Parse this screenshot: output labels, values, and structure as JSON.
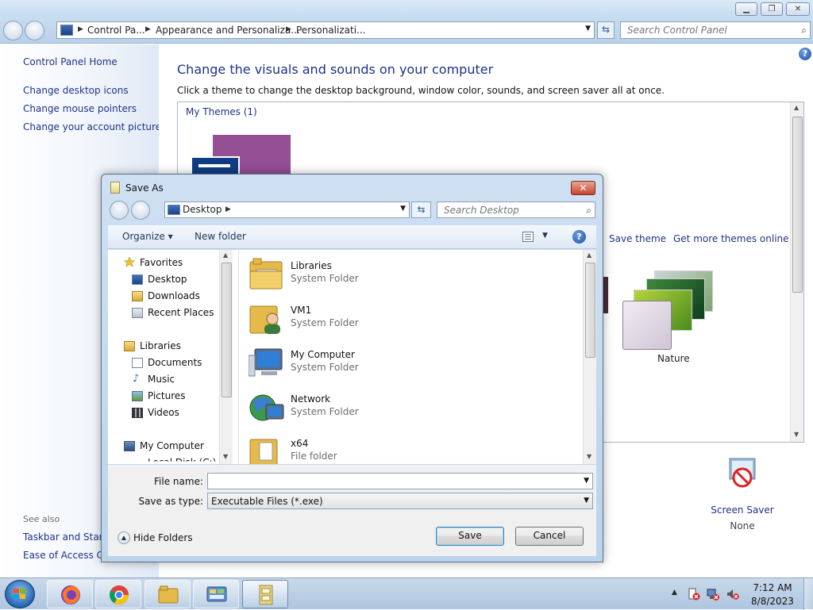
{
  "control_panel": {
    "breadcrumbs": [
      "Control Pa...",
      "Appearance and Personaliza...",
      "Personalizati..."
    ],
    "search_placeholder": "Search Control Panel",
    "left_links": [
      "Control Panel Home",
      "Change desktop icons",
      "Change mouse pointers",
      "Change your account picture"
    ],
    "see_also_label": "See also",
    "see_also_links": [
      "Taskbar and Start M",
      "Ease of Access Cer"
    ],
    "heading": "Change the visuals and sounds on your computer",
    "subheading": "Click a theme to change the desktop background, window color, sounds, and screen saver all at once.",
    "my_themes_label": "My Themes (1)",
    "save_theme": "Save theme",
    "get_more_themes": "Get more themes online",
    "nature_theme": "Nature",
    "screen_saver_label": "Screen Saver",
    "screen_saver_value": "None",
    "help_glyph": "?"
  },
  "dialog": {
    "title": "Save As",
    "close_glyph": "✕",
    "location": "Desktop",
    "search_placeholder": "Search Desktop",
    "toolbar": {
      "organize": "Organize ▾",
      "new_folder": "New folder",
      "help_glyph": "?"
    },
    "nav": {
      "favorites": "Favorites",
      "favorites_items": [
        "Desktop",
        "Downloads",
        "Recent Places"
      ],
      "libraries": "Libraries",
      "libraries_items": [
        "Documents",
        "Music",
        "Pictures",
        "Videos"
      ],
      "computer": "My Computer",
      "computer_partial": "Local Disk (C:)"
    },
    "files": [
      {
        "name": "Libraries",
        "type": "System Folder"
      },
      {
        "name": "VM1",
        "type": "System Folder"
      },
      {
        "name": "My Computer",
        "type": "System Folder"
      },
      {
        "name": "Network",
        "type": "System Folder"
      },
      {
        "name": "x64",
        "type": "File folder"
      }
    ],
    "file_name_label": "File name:",
    "file_name_value": "",
    "save_as_type_label": "Save as type:",
    "save_as_type_value": "Executable Files (*.exe)",
    "hide_folders": "Hide Folders",
    "save_button": "Save",
    "cancel_button": "Cancel"
  },
  "taskbar": {
    "time": "7:12 AM",
    "date": "8/8/2023"
  }
}
